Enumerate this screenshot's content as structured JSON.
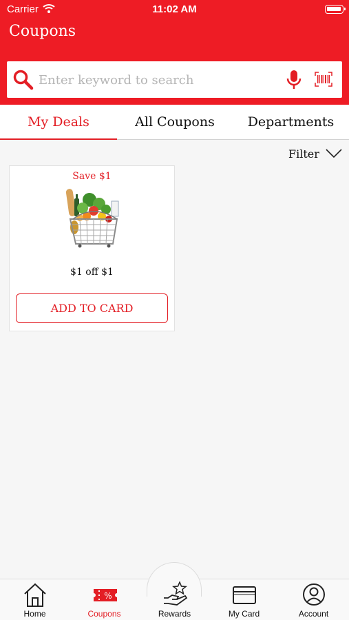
{
  "status_bar": {
    "carrier": "Carrier",
    "time": "11:02 AM"
  },
  "header": {
    "title": "Coupons"
  },
  "search": {
    "placeholder": "Enter keyword to search",
    "value": ""
  },
  "tabs": [
    {
      "label": "My Deals",
      "active": true
    },
    {
      "label": "All Coupons",
      "active": false
    },
    {
      "label": "Departments",
      "active": false
    }
  ],
  "filter": {
    "label": "Filter"
  },
  "coupons": [
    {
      "save_text": "Save $1",
      "offer": "$1 off $1",
      "button_label": "ADD TO CARD",
      "image": "grocery-basket"
    }
  ],
  "bottom_nav": [
    {
      "label": "Home",
      "icon": "home-icon",
      "active": false
    },
    {
      "label": "Coupons",
      "icon": "coupon-ticket-icon",
      "active": true
    },
    {
      "label": "Rewards",
      "icon": "rewards-hand-star-icon",
      "active": false
    },
    {
      "label": "My Card",
      "icon": "card-icon",
      "active": false
    },
    {
      "label": "Account",
      "icon": "account-icon",
      "active": false
    }
  ],
  "colors": {
    "brand_red": "#ee1c25",
    "accent_red": "#e31e25",
    "background": "#f6f6f6"
  }
}
